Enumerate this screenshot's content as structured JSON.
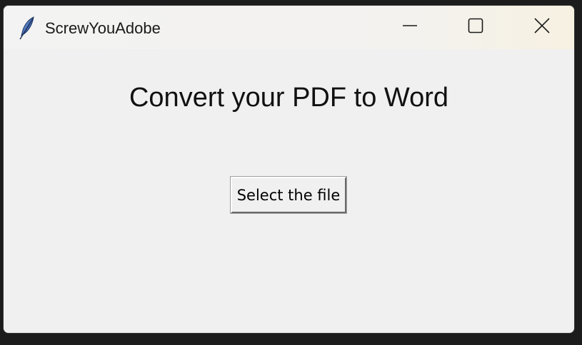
{
  "window": {
    "title": "ScrewYouAdobe",
    "app_icon": "feather-icon",
    "controls": {
      "minimize_icon": "minimize-icon",
      "maximize_icon": "maximize-icon",
      "close_icon": "close-icon"
    }
  },
  "main": {
    "heading": "Convert your PDF to Word",
    "select_button_label": "Select the file"
  },
  "colors": {
    "window_background": "#f0f0f0",
    "titlebar_background": "#f3f3f3",
    "desktop_background": "#1c1c1c",
    "text": "#111111"
  }
}
